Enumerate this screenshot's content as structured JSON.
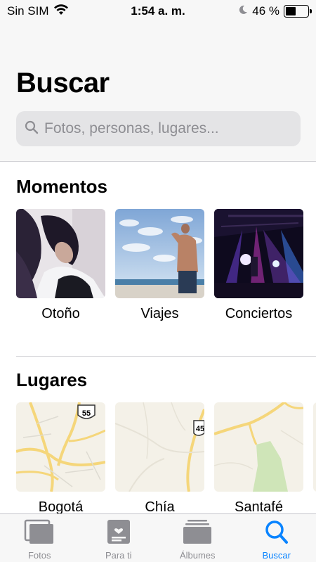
{
  "status_bar": {
    "carrier": "Sin SIM",
    "time": "1:54 a. m.",
    "battery_percent": "46 %",
    "battery_level": 0.46
  },
  "page": {
    "title": "Buscar"
  },
  "search": {
    "placeholder": "Fotos, personas, lugares..."
  },
  "moments": {
    "title": "Momentos",
    "items": [
      {
        "label": "Otoño"
      },
      {
        "label": "Viajes"
      },
      {
        "label": "Conciertos"
      }
    ]
  },
  "places": {
    "title": "Lugares",
    "items": [
      {
        "label": "Bogotá",
        "shield": "55"
      },
      {
        "label": "Chía",
        "shield": "45"
      },
      {
        "label": "Santafé"
      }
    ]
  },
  "tab_bar": {
    "tabs": [
      {
        "label": "Fotos",
        "icon": "photos-icon"
      },
      {
        "label": "Para ti",
        "icon": "for-you-icon"
      },
      {
        "label": "Álbumes",
        "icon": "albums-icon"
      },
      {
        "label": "Buscar",
        "icon": "search-icon",
        "active": true
      }
    ],
    "active_color": "#0a84ff",
    "inactive_color": "#8e8e93"
  }
}
